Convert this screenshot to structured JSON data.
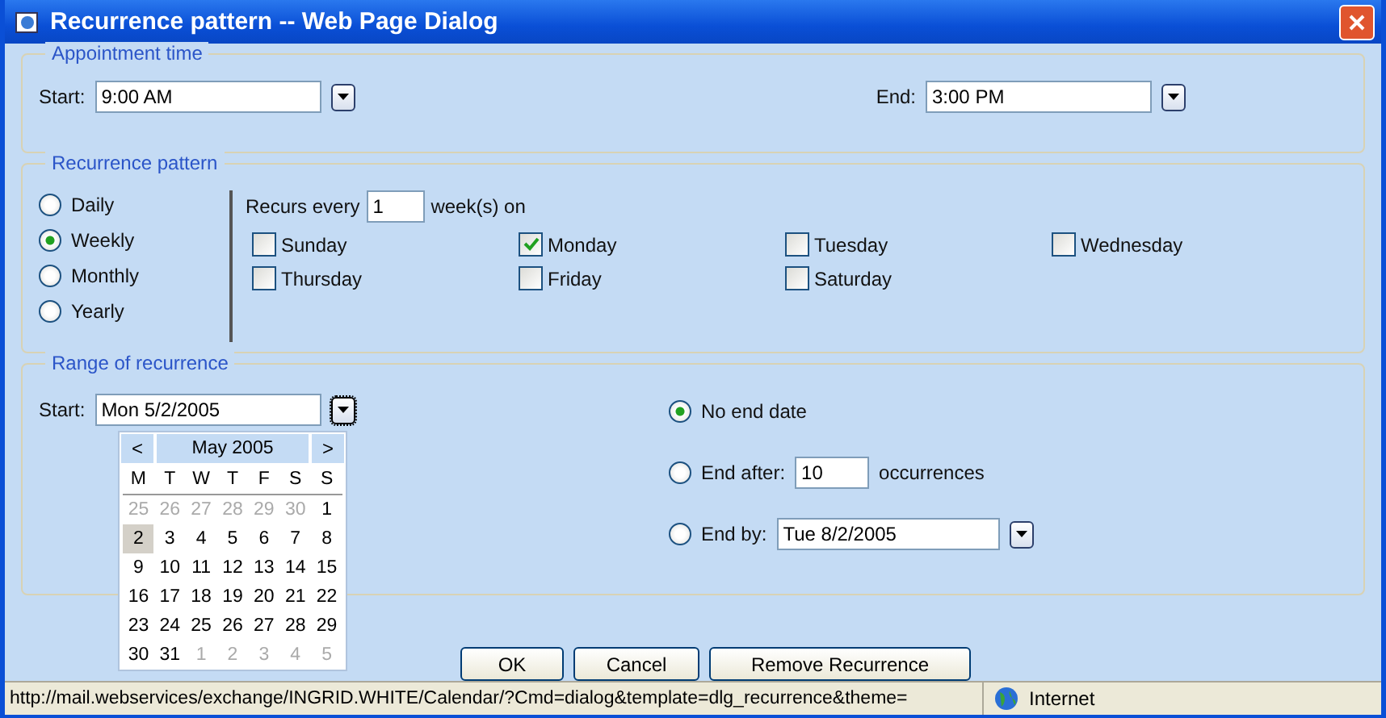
{
  "window": {
    "title": "Recurrence pattern -- Web Page Dialog"
  },
  "appointment_time": {
    "legend": "Appointment time",
    "start": {
      "label": "Start:",
      "value": "9:00 AM"
    },
    "end": {
      "label": "End:",
      "value": "3:00 PM"
    }
  },
  "recurrence_pattern": {
    "legend": "Recurrence pattern",
    "options": [
      {
        "label": "Daily",
        "selected": false
      },
      {
        "label": "Weekly",
        "selected": true
      },
      {
        "label": "Monthly",
        "selected": false
      },
      {
        "label": "Yearly",
        "selected": false
      }
    ],
    "recurs_label": "Recurs every",
    "interval": "1",
    "unit": "week(s) on",
    "days": [
      {
        "label": "Sunday",
        "checked": false
      },
      {
        "label": "Monday",
        "checked": true
      },
      {
        "label": "Tuesday",
        "checked": false
      },
      {
        "label": "Wednesday",
        "checked": false
      },
      {
        "label": "Thursday",
        "checked": false
      },
      {
        "label": "Friday",
        "checked": false
      },
      {
        "label": "Saturday",
        "checked": false
      }
    ]
  },
  "range": {
    "legend": "Range of recurrence",
    "start": {
      "label": "Start:",
      "value": "Mon 5/2/2005"
    },
    "end_options": [
      {
        "kind": "plain",
        "label": "No end date",
        "selected": true
      },
      {
        "kind": "count",
        "label": "End after:",
        "value": "10",
        "suffix": "occurrences",
        "selected": false
      },
      {
        "kind": "date",
        "label": "End by:",
        "value": "Tue 8/2/2005",
        "selected": false
      }
    ]
  },
  "calendar": {
    "prev": "<",
    "month": "May 2005",
    "next": ">",
    "weekdays": [
      "M",
      "T",
      "W",
      "T",
      "F",
      "S",
      "S"
    ],
    "weeks": [
      [
        {
          "day": "25",
          "in_month": false,
          "selected": false
        },
        {
          "day": "26",
          "in_month": false,
          "selected": false
        },
        {
          "day": "27",
          "in_month": false,
          "selected": false
        },
        {
          "day": "28",
          "in_month": false,
          "selected": false
        },
        {
          "day": "29",
          "in_month": false,
          "selected": false
        },
        {
          "day": "30",
          "in_month": false,
          "selected": false
        },
        {
          "day": "1",
          "in_month": true,
          "selected": false
        }
      ],
      [
        {
          "day": "2",
          "in_month": true,
          "selected": true
        },
        {
          "day": "3",
          "in_month": true,
          "selected": false
        },
        {
          "day": "4",
          "in_month": true,
          "selected": false
        },
        {
          "day": "5",
          "in_month": true,
          "selected": false
        },
        {
          "day": "6",
          "in_month": true,
          "selected": false
        },
        {
          "day": "7",
          "in_month": true,
          "selected": false
        },
        {
          "day": "8",
          "in_month": true,
          "selected": false
        }
      ],
      [
        {
          "day": "9",
          "in_month": true,
          "selected": false
        },
        {
          "day": "10",
          "in_month": true,
          "selected": false
        },
        {
          "day": "11",
          "in_month": true,
          "selected": false
        },
        {
          "day": "12",
          "in_month": true,
          "selected": false
        },
        {
          "day": "13",
          "in_month": true,
          "selected": false
        },
        {
          "day": "14",
          "in_month": true,
          "selected": false
        },
        {
          "day": "15",
          "in_month": true,
          "selected": false
        }
      ],
      [
        {
          "day": "16",
          "in_month": true,
          "selected": false
        },
        {
          "day": "17",
          "in_month": true,
          "selected": false
        },
        {
          "day": "18",
          "in_month": true,
          "selected": false
        },
        {
          "day": "19",
          "in_month": true,
          "selected": false
        },
        {
          "day": "20",
          "in_month": true,
          "selected": false
        },
        {
          "day": "21",
          "in_month": true,
          "selected": false
        },
        {
          "day": "22",
          "in_month": true,
          "selected": false
        }
      ],
      [
        {
          "day": "23",
          "in_month": true,
          "selected": false
        },
        {
          "day": "24",
          "in_month": true,
          "selected": false
        },
        {
          "day": "25",
          "in_month": true,
          "selected": false
        },
        {
          "day": "26",
          "in_month": true,
          "selected": false
        },
        {
          "day": "27",
          "in_month": true,
          "selected": false
        },
        {
          "day": "28",
          "in_month": true,
          "selected": false
        },
        {
          "day": "29",
          "in_month": true,
          "selected": false
        }
      ],
      [
        {
          "day": "30",
          "in_month": true,
          "selected": false
        },
        {
          "day": "31",
          "in_month": true,
          "selected": false
        },
        {
          "day": "1",
          "in_month": false,
          "selected": false
        },
        {
          "day": "2",
          "in_month": false,
          "selected": false
        },
        {
          "day": "3",
          "in_month": false,
          "selected": false
        },
        {
          "day": "4",
          "in_month": false,
          "selected": false
        },
        {
          "day": "5",
          "in_month": false,
          "selected": false
        }
      ]
    ]
  },
  "buttons": [
    "OK",
    "Cancel",
    "Remove Recurrence"
  ],
  "status_bar": {
    "url": "http://mail.webservices/exchange/INGRID.WHITE/Calendar/?Cmd=dialog&template=dlg_recurrence&theme=",
    "zone": "Internet"
  }
}
